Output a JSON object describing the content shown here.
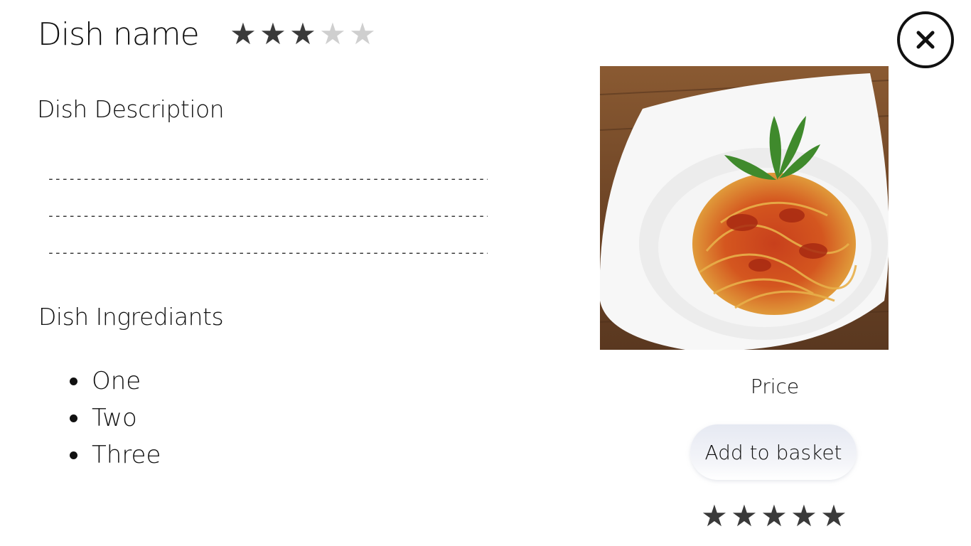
{
  "dish": {
    "title": "Dish name",
    "rating": {
      "value": 3,
      "max": 5
    }
  },
  "close": {
    "icon": "close-icon"
  },
  "description": {
    "heading": "Dish Description",
    "lines": [
      "-------------------------------------------------------------------",
      "-------------------------------------------------------------------",
      "-------------------------------------------------------------------"
    ]
  },
  "ingredients": {
    "heading": "Dish Ingrediants",
    "items": [
      "One",
      "Two",
      "Three"
    ]
  },
  "image": {
    "alt": "spaghetti-dish-image"
  },
  "price": {
    "label": "Price"
  },
  "basket": {
    "label": "Add to basket"
  },
  "user_rating": {
    "value": 5,
    "max": 5
  },
  "colors": {
    "star_filled": "#3a3a3a",
    "star_empty": "#cfcfcf",
    "button_bg": "#e9ecf4",
    "text": "#111111"
  }
}
